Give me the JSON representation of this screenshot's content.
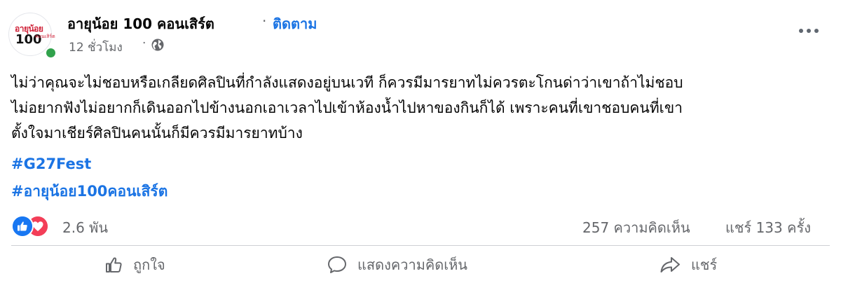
{
  "header": {
    "page_name": "อายุน้อย 100 คอนเสิร์ต",
    "separator": "·",
    "follow_label": "ติดตาม",
    "time_ago": "12 ชั่วโมง",
    "meta_separator": "·",
    "privacy_icon": "globe-icon",
    "more_icon": "more-horiz-icon"
  },
  "avatar": {
    "logo_text_top": "อายุน้อย",
    "logo_text_num": "100",
    "logo_text_sub": "คอนเสิร์ต",
    "online": true
  },
  "post": {
    "lines": [
      "ไม่ว่าคุณจะไม่ชอบหรือเกลียดศิลปินที่กำลังแสดงอยู่บนเวที ก็ควรมีมารยาทไม่ควรตะโกนด่าว่าเขาถ้าไม่ชอบ",
      "ไม่อยากฟังไม่อยากก็เดินออกไปข้างนอกเอาเวลาไปเข้าห้องน้ำไปหาของกินก็ได้ เพราะคนที่เขาชอบคนที่เขา",
      "ตั้งใจมาเชียร์ศิลปินคนนั้นก็มีควรมีมารยาทบ้าง"
    ],
    "hashtags": [
      "#G27Fest",
      "#อายุน้อย100คอนเสิร์ต"
    ]
  },
  "stats": {
    "reactions_count": "2.6 พัน",
    "comments": "257 ความคิดเห็น",
    "shares": "แชร์ 133 ครั้ง"
  },
  "actions": {
    "like_label": "ถูกใจ",
    "comment_label": "แสดงความคิดเห็น",
    "share_label": "แชร์"
  },
  "colors": {
    "accent": "#1b74e4",
    "like": "#1877f2",
    "love": "#f33e58",
    "secondary_text": "#65676b",
    "online": "#31a24c"
  }
}
